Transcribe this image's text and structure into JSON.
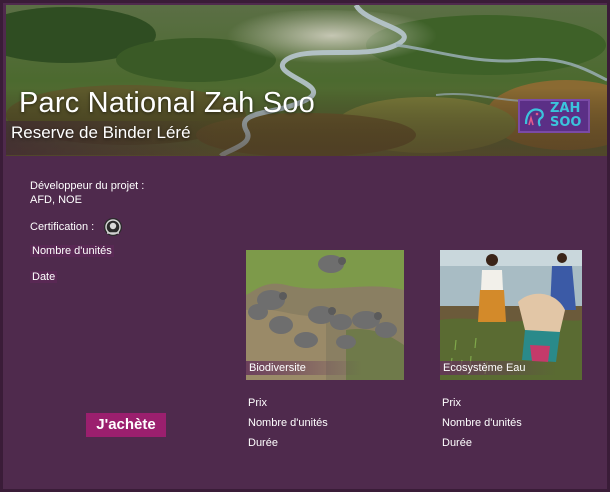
{
  "hero": {
    "title": "Parc National Zah Soo",
    "subtitle": "Reserve de Binder Léré",
    "logo_text_line1": "ZAH",
    "logo_text_line2": "SOO"
  },
  "project_info": {
    "developer_label": "Développeur du projet :",
    "developer_value": "AFD, NOE",
    "certification_label": "Certification :",
    "certification_icon": "certification-badge-icon",
    "units_label": "Nombre d'unités",
    "date_label": "Date"
  },
  "buy_button_label": "J'achète",
  "cards": [
    {
      "caption": "Biodiversite",
      "image": "elephants-aerial",
      "price_label": "Prix",
      "units_label": "Nombre d'unités",
      "duration_label": "Durée"
    },
    {
      "caption": "Ecosystème Eau",
      "image": "women-planting-rice",
      "price_label": "Prix",
      "units_label": "Nombre d'unités",
      "duration_label": "Durée"
    }
  ],
  "colors": {
    "background": "#4f2a4d",
    "button": "#9b1f6e",
    "logo_bg": "#5b2f86",
    "logo_text": "#3bc4dc"
  }
}
